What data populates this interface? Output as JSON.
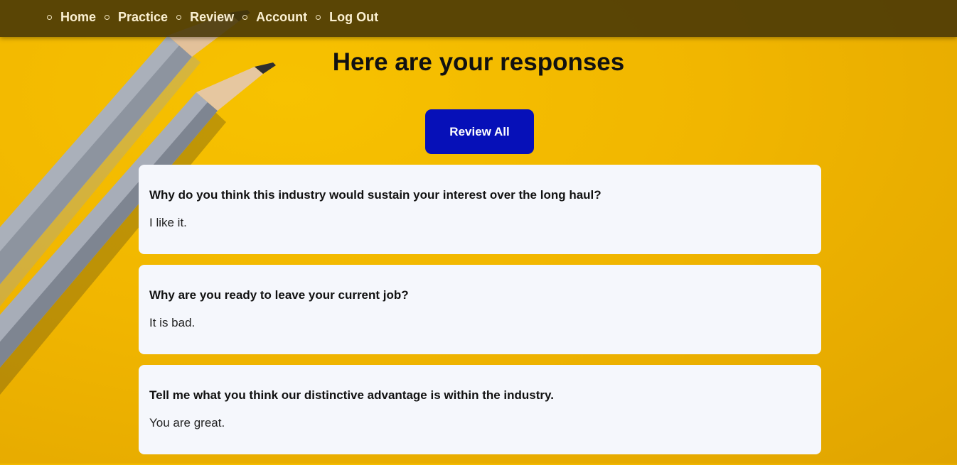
{
  "nav": {
    "items": [
      {
        "label": "Home"
      },
      {
        "label": "Practice"
      },
      {
        "label": "Review"
      },
      {
        "label": "Account"
      },
      {
        "label": "Log Out"
      }
    ]
  },
  "page": {
    "title": "Here are your responses"
  },
  "actions": {
    "review_all_label": "Review All"
  },
  "responses": [
    {
      "question": "Why do you think this industry would sustain your interest over the long haul?",
      "answer": "I like it."
    },
    {
      "question": "Why are you ready to leave your current job?",
      "answer": "It is bad."
    },
    {
      "question": "Tell me what you think our distinctive advantage is within the industry.",
      "answer": "You are great."
    }
  ],
  "colors": {
    "background": "#f1b600",
    "navbar": "#443406",
    "button": "#0610b8",
    "card": "#f5f7fc"
  }
}
